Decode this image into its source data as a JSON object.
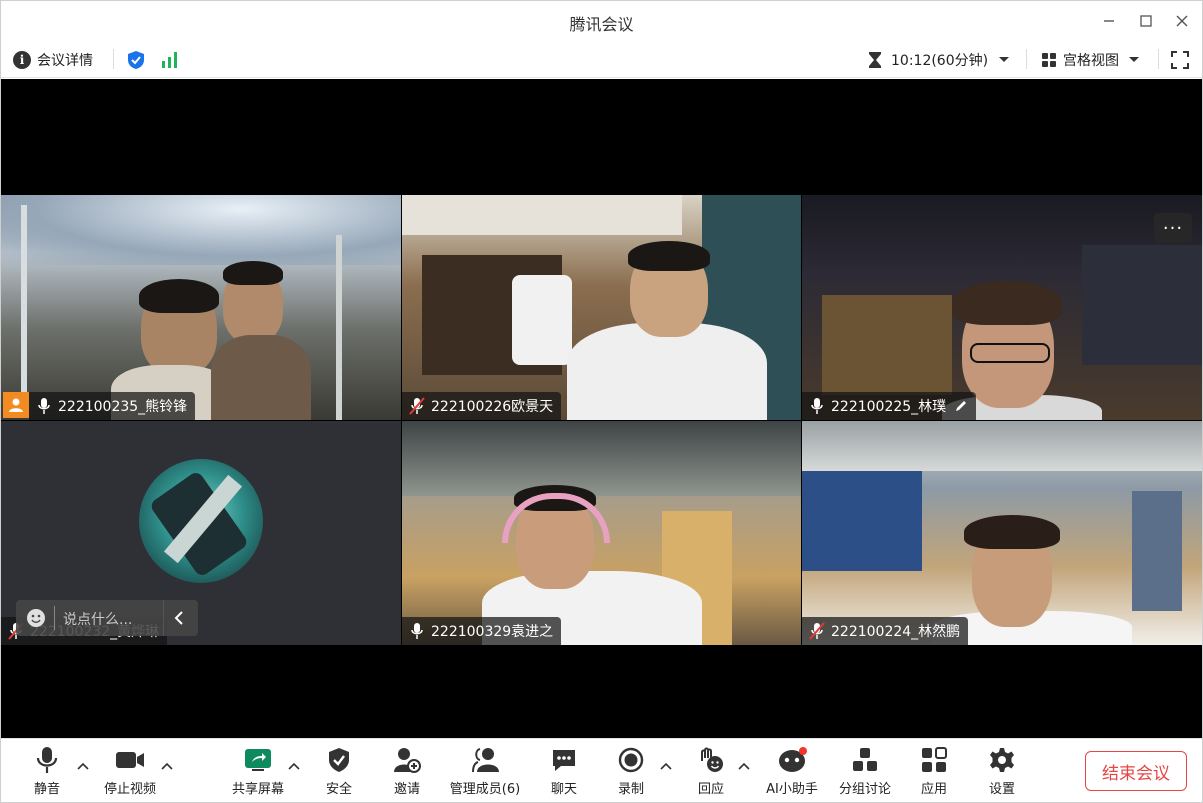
{
  "window": {
    "title": "腾讯会议"
  },
  "infobar": {
    "meeting_details": "会议详情",
    "timer": "10:12(60分钟)",
    "view_mode": "宫格视图"
  },
  "participants": [
    {
      "name": "222100235_熊铃锋",
      "mic": "on",
      "host": true,
      "active": true
    },
    {
      "name": "222100226欧景天",
      "mic": "muted"
    },
    {
      "name": "222100225_林璞",
      "mic": "on",
      "editing": true
    },
    {
      "name": "222100232_黄烨琳",
      "mic": "muted",
      "video": "off"
    },
    {
      "name": "222100329袁进之",
      "mic": "on"
    },
    {
      "name": "222100224_林然鹏",
      "mic": "muted"
    }
  ],
  "chat": {
    "placeholder": "说点什么..."
  },
  "controls": {
    "mute": "静音",
    "stop_video": "停止视频",
    "share_screen": "共享屏幕",
    "security": "安全",
    "invite": "邀请",
    "manage_members": "管理成员(6)",
    "chat": "聊天",
    "record": "录制",
    "react": "回应",
    "ai_assistant": "AI小助手",
    "breakout": "分组讨论",
    "apps": "应用",
    "settings": "设置",
    "end_meeting": "结束会议"
  },
  "colors": {
    "active_border": "#13c553",
    "end_button": "#e64545",
    "host_badge": "#f28b21",
    "shield": "#1a73e8"
  }
}
